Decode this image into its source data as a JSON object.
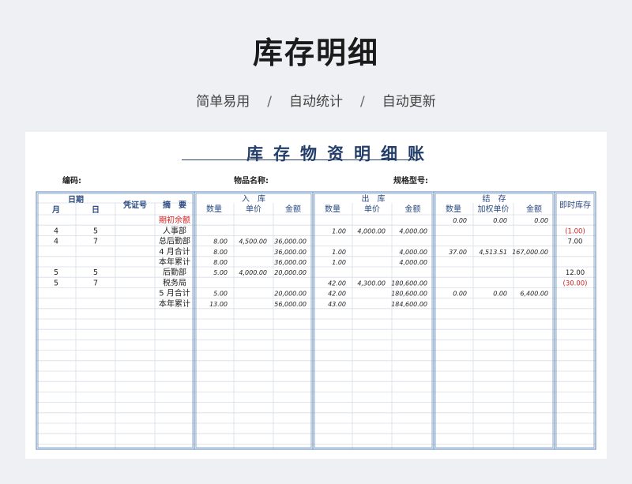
{
  "page": {
    "title": "库存明细",
    "features": [
      "简单易用",
      "自动统计",
      "自动更新"
    ],
    "separator": "/"
  },
  "ledger": {
    "title": "库存物资明细账",
    "code_label": "编码:",
    "name_label": "物品名称:",
    "spec_label": "规格型号:",
    "headers": {
      "date": "日期",
      "month": "月",
      "day": "日",
      "voucher": "凭证号",
      "summary": "摘　要",
      "in_group": "入　库",
      "out_group": "出　库",
      "balance_group": "结　存",
      "qty": "数量",
      "price": "单价",
      "amount": "金额",
      "weighted_price": "加权单价",
      "instant": "即时库存"
    },
    "rows": [
      {
        "m": "",
        "d": "",
        "v": "",
        "s": "期初余额",
        "in_q": "",
        "in_p": "",
        "in_a": "",
        "out_q": "",
        "out_p": "",
        "out_a": "",
        "b_q": "0.00",
        "b_p": "0.00",
        "b_a": "0.00",
        "inst": "",
        "red_s": true,
        "red_i": false
      },
      {
        "m": "4",
        "d": "5",
        "v": "",
        "s": "人事部",
        "in_q": "",
        "in_p": "",
        "in_a": "",
        "out_q": "1.00",
        "out_p": "4,000.00",
        "out_a": "4,000.00",
        "b_q": "",
        "b_p": "",
        "b_a": "",
        "inst": "(1.00)",
        "red_s": false,
        "red_i": true
      },
      {
        "m": "4",
        "d": "7",
        "v": "",
        "s": "总后勤部",
        "in_q": "8.00",
        "in_p": "4,500.00",
        "in_a": "36,000.00",
        "out_q": "",
        "out_p": "",
        "out_a": "",
        "b_q": "",
        "b_p": "",
        "b_a": "",
        "inst": "7.00",
        "red_s": false,
        "red_i": false
      },
      {
        "m": "",
        "d": "",
        "v": "",
        "s": "4 月合计",
        "in_q": "8.00",
        "in_p": "",
        "in_a": "36,000.00",
        "out_q": "1.00",
        "out_p": "",
        "out_a": "4,000.00",
        "b_q": "37.00",
        "b_p": "4,513.51",
        "b_a": "167,000.00",
        "inst": "",
        "red_s": false,
        "red_i": false
      },
      {
        "m": "",
        "d": "",
        "v": "",
        "s": "本年累计",
        "in_q": "8.00",
        "in_p": "",
        "in_a": "36,000.00",
        "out_q": "1.00",
        "out_p": "",
        "out_a": "4,000.00",
        "b_q": "",
        "b_p": "",
        "b_a": "",
        "inst": "",
        "red_s": false,
        "red_i": false
      },
      {
        "m": "5",
        "d": "5",
        "v": "",
        "s": "后勤部",
        "in_q": "5.00",
        "in_p": "4,000.00",
        "in_a": "20,000.00",
        "out_q": "",
        "out_p": "",
        "out_a": "",
        "b_q": "",
        "b_p": "",
        "b_a": "",
        "inst": "12.00",
        "red_s": false,
        "red_i": false
      },
      {
        "m": "5",
        "d": "7",
        "v": "",
        "s": "税务局",
        "in_q": "",
        "in_p": "",
        "in_a": "",
        "out_q": "42.00",
        "out_p": "4,300.00",
        "out_a": "180,600.00",
        "b_q": "",
        "b_p": "",
        "b_a": "",
        "inst": "(30.00)",
        "red_s": false,
        "red_i": true
      },
      {
        "m": "",
        "d": "",
        "v": "",
        "s": "5 月合计",
        "in_q": "5.00",
        "in_p": "",
        "in_a": "20,000.00",
        "out_q": "42.00",
        "out_p": "",
        "out_a": "180,600.00",
        "b_q": "0.00",
        "b_p": "0.00",
        "b_a": "6,400.00",
        "inst": "",
        "red_s": false,
        "red_i": false
      },
      {
        "m": "",
        "d": "",
        "v": "",
        "s": "本年累计",
        "in_q": "13.00",
        "in_p": "",
        "in_a": "56,000.00",
        "out_q": "43.00",
        "out_p": "",
        "out_a": "184,600.00",
        "b_q": "",
        "b_p": "",
        "b_a": "",
        "inst": "",
        "red_s": false,
        "red_i": false
      }
    ]
  },
  "colors": {
    "frame": "#5b86b5",
    "grid": "#d6dde6",
    "header_text": "#2b4a80",
    "red": "#d22020"
  }
}
